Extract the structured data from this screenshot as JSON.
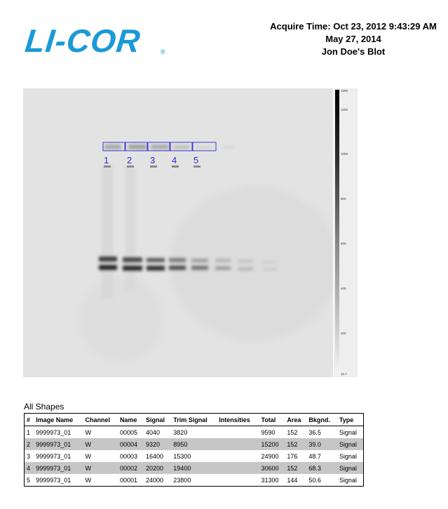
{
  "logo": {
    "text": "LI-COR",
    "reg": "®"
  },
  "header": {
    "acquire_time": "Acquire Time: Oct 23, 2012 9:43:29 AM",
    "date": "May 27, 2014",
    "blot_name": "Jon Doe's Blot"
  },
  "blot": {
    "lane_labels": [
      "1",
      "2",
      "3",
      "4",
      "5"
    ]
  },
  "scale": {
    "ticks": [
      "1200",
      "1000",
      "800",
      "600",
      "400",
      "200",
      "10.7"
    ],
    "top_label": "1200"
  },
  "table": {
    "caption": "All Shapes",
    "columns": [
      "#",
      "Image Name",
      "Channel",
      "Name",
      "Signal",
      "Trim Signal",
      "Intensities",
      "Total",
      "Area",
      "Bkgnd.",
      "Type"
    ],
    "rows": [
      [
        "1",
        "9999973_01",
        "W",
        "00005",
        "4040",
        "3820",
        "",
        "9590",
        "152",
        "36.5",
        "Signal"
      ],
      [
        "2",
        "9999973_01",
        "W",
        "00004",
        "9320",
        "8950",
        "",
        "15200",
        "152",
        "39.0",
        "Signal"
      ],
      [
        "3",
        "9999973_01",
        "W",
        "00003",
        "16400",
        "15300",
        "",
        "24900",
        "176",
        "48.7",
        "Signal"
      ],
      [
        "4",
        "9999973_01",
        "W",
        "00002",
        "20200",
        "19400",
        "",
        "30600",
        "152",
        "68.3",
        "Signal"
      ],
      [
        "5",
        "9999973_01",
        "W",
        "00001",
        "24000",
        "23800",
        "",
        "31300",
        "144",
        "50.6",
        "Signal"
      ]
    ]
  }
}
